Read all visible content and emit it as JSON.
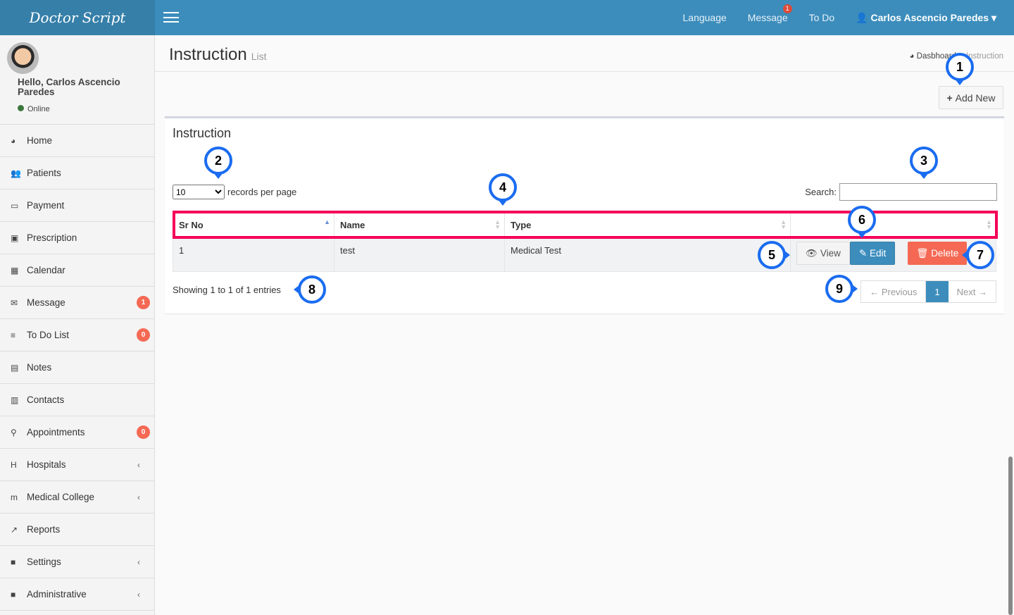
{
  "app": {
    "logo": "Doctor Script"
  },
  "topnav": {
    "language": "Language",
    "message": "Message",
    "message_badge": "1",
    "todo": "To Do",
    "user": "Carlos Ascencio Paredes"
  },
  "user": {
    "hello": "Hello, Carlos Ascencio Paredes",
    "status": "Online"
  },
  "sidebar": {
    "items": [
      {
        "label": "Home",
        "icon": "dashboard-icon"
      },
      {
        "label": "Patients",
        "icon": "users-icon"
      },
      {
        "label": "Payment",
        "icon": "credit-card-icon"
      },
      {
        "label": "Prescription",
        "icon": "medkit-icon"
      },
      {
        "label": "Calendar",
        "icon": "calendar-icon"
      },
      {
        "label": "Message",
        "icon": "envelope-icon",
        "badge": "1"
      },
      {
        "label": "To Do List",
        "icon": "list-icon",
        "badge": "0"
      },
      {
        "label": "Notes",
        "icon": "file-icon"
      },
      {
        "label": "Contacts",
        "icon": "address-card-icon"
      },
      {
        "label": "Appointments",
        "icon": "pin-icon",
        "badge": "0"
      },
      {
        "label": "Hospitals",
        "icon": "hospital-icon",
        "chevron": "‹"
      },
      {
        "label": "Medical College",
        "icon": "college-icon",
        "chevron": "‹"
      },
      {
        "label": "Reports",
        "icon": "chart-icon"
      },
      {
        "label": "Settings",
        "icon": "folder-icon",
        "chevron": "‹"
      },
      {
        "label": "Administrative",
        "icon": "folder-icon",
        "chevron": "‹"
      }
    ]
  },
  "page": {
    "title": "Instruction",
    "subtitle": "List",
    "breadcrumb": [
      "Dasbhoard",
      "Instruction"
    ],
    "add_new": "Add New"
  },
  "box": {
    "title": "Instruction",
    "length_value": "10",
    "length_label": "records per page",
    "search_label": "Search:",
    "search_value": "",
    "columns": [
      "Sr No",
      "Name",
      "Type",
      ""
    ],
    "rows": [
      {
        "sr": "1",
        "name": "test",
        "type": "Medical Test"
      }
    ],
    "actions": {
      "view": "View",
      "edit": "Edit",
      "delete": "Delete"
    },
    "info": "Showing 1 to 1 of 1 entries",
    "pager": {
      "prev": "← Previous",
      "page": "1",
      "next": "Next →"
    }
  },
  "callouts": [
    "1",
    "2",
    "3",
    "4",
    "5",
    "6",
    "7",
    "8",
    "9"
  ],
  "colors": {
    "header": "#3c8dbc",
    "logo_bg": "#367fa9",
    "danger": "#f56954",
    "callout": "#1a6cf0",
    "highlight": "#f50057"
  }
}
